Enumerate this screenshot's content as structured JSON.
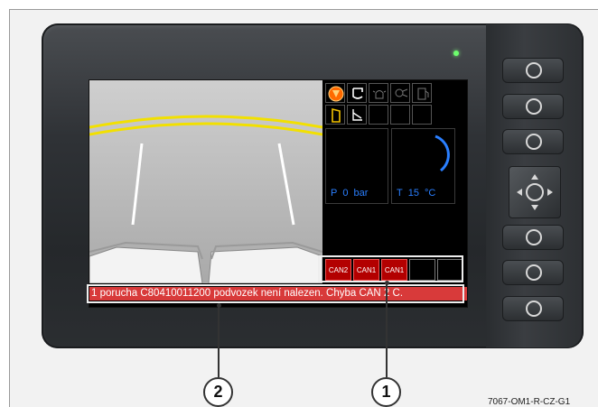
{
  "display": {
    "status_message": "1 porucha C80410011200 podvozek není nalezen. Chyba CAN 2 C.",
    "gauges": {
      "pressure": {
        "label": "P",
        "value": "0",
        "unit": "bar"
      },
      "temperature": {
        "label": "T",
        "value": "15",
        "unit": "°C"
      }
    },
    "can_indicators": [
      {
        "label": "CAN2",
        "active": true
      },
      {
        "label": "CAN1",
        "active": true
      },
      {
        "label": "CAN1",
        "active": true
      },
      {
        "label": "",
        "active": false
      },
      {
        "label": "",
        "active": false
      }
    ],
    "icons_row1": [
      "warning-triangle-icon",
      "seat-icon",
      "beacon-light-icon",
      "work-light-icon",
      "fuel-icon"
    ],
    "icons_row2": [
      "door-icon",
      "seat-tilt-icon"
    ]
  },
  "callouts": {
    "one": "1",
    "two": "2"
  },
  "figure_code": "7067-OM1-R-CZ-G1",
  "colors": {
    "status_bg": "#d83a3a",
    "gauge_text": "#2a7fff",
    "can_active": "#b30000",
    "icon_yellow": "#f2c200",
    "icon_orange": "#ff6a00",
    "led": "#6dff6d"
  }
}
